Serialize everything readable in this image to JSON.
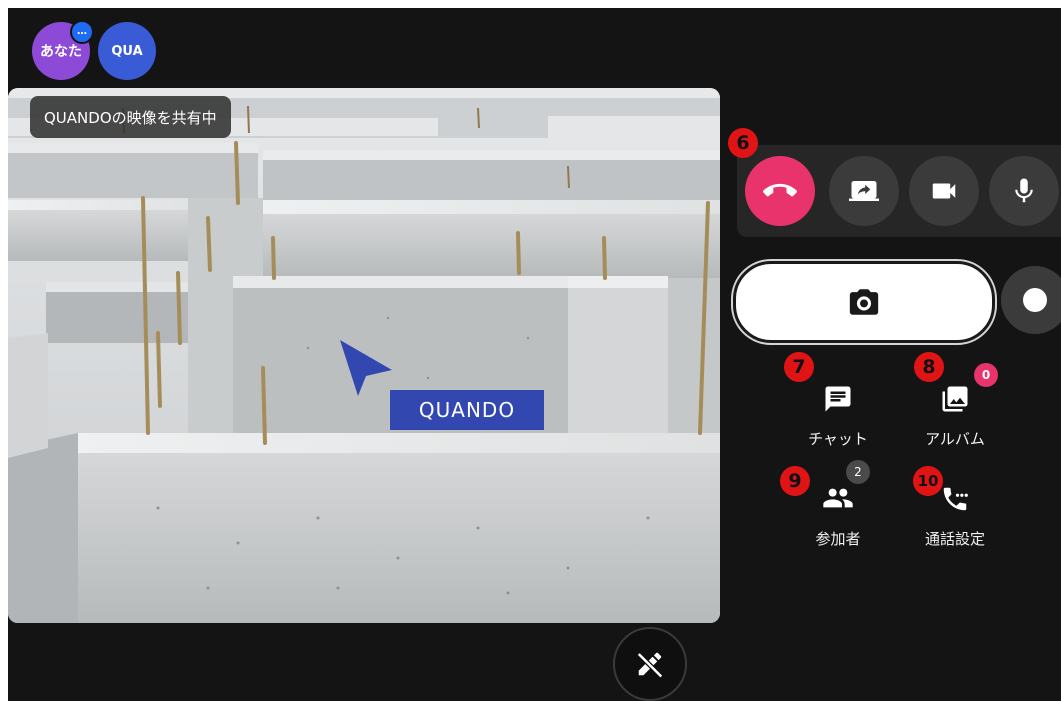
{
  "participants": [
    {
      "label": "あなた",
      "color": "#8c4ad6",
      "status_dot": "…"
    },
    {
      "label": "QUA",
      "color": "#3a5bd6"
    }
  ],
  "video": {
    "share_label": "QUANDOの映像を共有中",
    "pointer_label": "QUANDO",
    "pointer_color": "#3347b0"
  },
  "controls": {
    "hangup_icon": "phone-hangup-icon",
    "hangup_color": "#e8336c",
    "share_icon": "screen-share-icon",
    "camera_icon": "video-camera-icon",
    "mic_icon": "microphone-icon",
    "snapshot_icon": "camera-icon",
    "record_icon": "record-icon"
  },
  "tools": {
    "chat": {
      "label": "チャット",
      "icon": "chat-icon"
    },
    "album": {
      "label": "アルバム",
      "icon": "photo-album-icon",
      "badge": "0"
    },
    "participants": {
      "label": "参加者",
      "icon": "people-icon",
      "badge": "2"
    },
    "call_settings": {
      "label": "通話設定",
      "icon": "phone-settings-icon"
    }
  },
  "markers": {
    "m6": "6",
    "m7": "7",
    "m8": "8",
    "m9": "9",
    "m10": "10"
  },
  "pen_icon": "pen-off-icon"
}
